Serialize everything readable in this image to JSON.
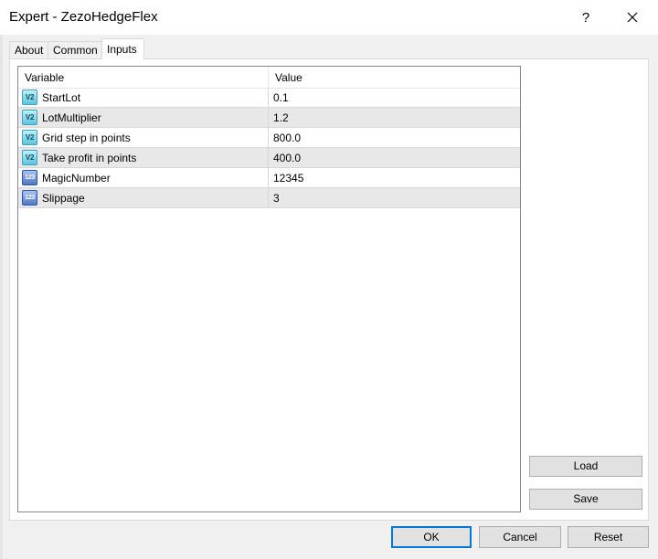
{
  "window": {
    "title": "Expert - ZezoHedgeFlex",
    "help_label": "?",
    "close_icon": "close-icon"
  },
  "tabs": [
    {
      "label": "About",
      "active": false
    },
    {
      "label": "Common",
      "active": false
    },
    {
      "label": "Inputs",
      "active": true
    }
  ],
  "table": {
    "columns": [
      "Variable",
      "Value"
    ],
    "rows": [
      {
        "type": "double",
        "icon_text": "V2",
        "name": "StartLot",
        "value": "0.1"
      },
      {
        "type": "double",
        "icon_text": "V2",
        "name": "LotMultiplier",
        "value": "1.2"
      },
      {
        "type": "double",
        "icon_text": "V2",
        "name": "Grid step in points",
        "value": "800.0"
      },
      {
        "type": "double",
        "icon_text": "V2",
        "name": "Take profit in points",
        "value": "400.0"
      },
      {
        "type": "int",
        "icon_text": "123",
        "name": "MagicNumber",
        "value": "12345"
      },
      {
        "type": "int",
        "icon_text": "123",
        "name": "Slippage",
        "value": "3"
      }
    ]
  },
  "side_buttons": {
    "load_label": "Load",
    "save_label": "Save"
  },
  "footer": {
    "ok_label": "OK",
    "cancel_label": "Cancel",
    "reset_label": "Reset"
  },
  "colors": {
    "accent": "#0078d7",
    "row_alt": "#e8e8e8"
  }
}
